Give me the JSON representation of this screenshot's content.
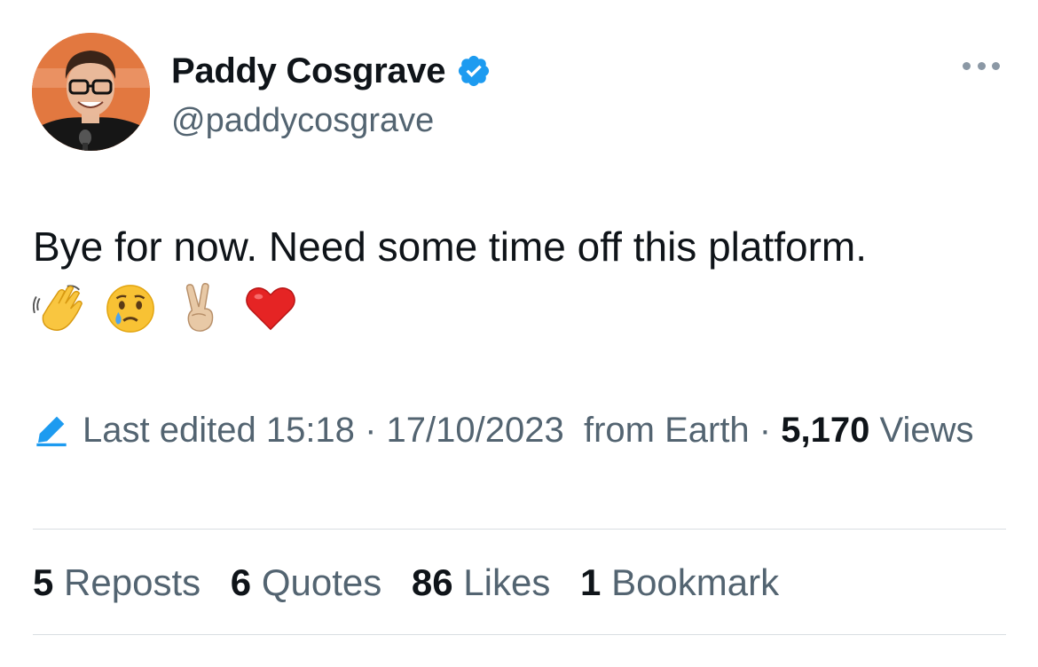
{
  "author": {
    "display_name": "Paddy Cosgrave",
    "handle": "@paddycosgrave",
    "verified": true,
    "verified_color": "#1d9bf0"
  },
  "tweet": {
    "text": "Bye for now. Need some time off this platform.",
    "emojis": [
      "waving-hand",
      "crying-face",
      "victory-hand",
      "red-heart"
    ],
    "edited_label": "Last edited",
    "time": "15:18",
    "date": "17/10/2023",
    "source": "from Earth",
    "views_count": "5,170",
    "views_label": "Views"
  },
  "stats": [
    {
      "count": "5",
      "label": "Reposts"
    },
    {
      "count": "6",
      "label": "Quotes"
    },
    {
      "count": "86",
      "label": "Likes"
    },
    {
      "count": "1",
      "label": "Bookmark"
    }
  ],
  "colors": {
    "text_primary": "#0f1419",
    "text_secondary": "#536471",
    "accent": "#1d9bf0",
    "divider": "#d9dee2"
  }
}
